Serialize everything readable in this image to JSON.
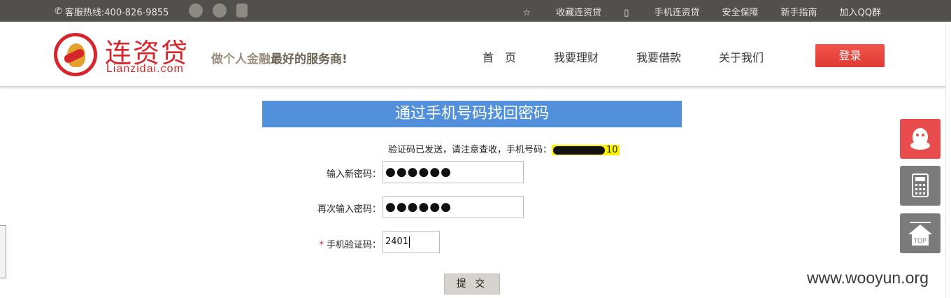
{
  "topbar": {
    "hotline": "客服热线:400-826-9855",
    "links": [
      "收藏连资贷",
      "手机连资贷",
      "安全保障",
      "新手指南",
      "加入QQ群"
    ]
  },
  "header": {
    "logo_cn": "连资贷",
    "logo_en": "Lianzidai.com",
    "slogan_a": "做个人金融",
    "slogan_b": "最好的服务商!",
    "nav": [
      "首　页",
      "我要理财",
      "我要借款",
      "关于我们"
    ],
    "login": "登录"
  },
  "form": {
    "title": "通过手机号码找回密码",
    "notice": "验证码已发送，请注意查收，手机号码：",
    "phone_suffix": "10",
    "new_pw_label": "输入新密码：",
    "new_pw_value": "●●●●●●",
    "confirm_pw_label": "再次输入密码：",
    "confirm_pw_value": "●●●●●●",
    "code_required": "*",
    "code_label": "手机验证码：",
    "code_value": "2401",
    "submit": "提 交"
  },
  "side_tools": [
    "qq-icon",
    "calculator-icon",
    "top-icon"
  ],
  "side_top_label": "TOP",
  "watermark": "www.wooyun.org",
  "colors": {
    "brand_red": "#d7262b",
    "banner_blue": "#5290db",
    "topbar": "#52504d"
  }
}
